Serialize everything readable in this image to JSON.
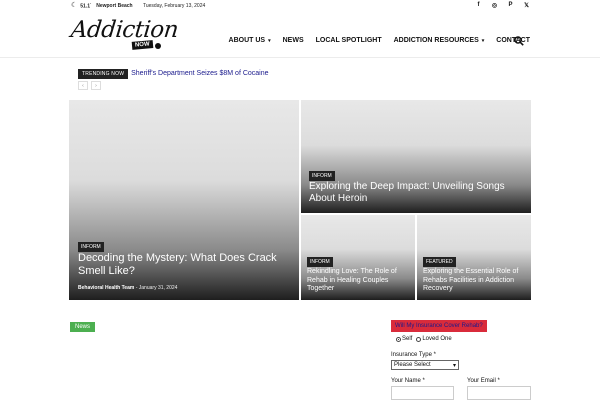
{
  "topbar": {
    "temperature": "51.1",
    "temp_unit": "°",
    "city": "Newport Beach",
    "date": "Tuesday, February 13, 2024",
    "social": [
      {
        "icon": "facebook-icon",
        "glyph": "f"
      },
      {
        "icon": "instagram-icon",
        "glyph": "◎"
      },
      {
        "icon": "pinterest-icon",
        "glyph": "P"
      },
      {
        "icon": "x-twitter-icon",
        "glyph": "𝕏"
      }
    ]
  },
  "logo": {
    "text": "Addiction",
    "badge": "NOW"
  },
  "nav": {
    "items": [
      {
        "label": "ABOUT US",
        "has_dropdown": true
      },
      {
        "label": "NEWS",
        "has_dropdown": false
      },
      {
        "label": "LOCAL SPOTLIGHT",
        "has_dropdown": false
      },
      {
        "label": "ADDICTION RESOURCES",
        "has_dropdown": true
      },
      {
        "label": "CONTACT",
        "has_dropdown": false
      }
    ]
  },
  "trending": {
    "badge": "TRENDING NOW",
    "headline": "Sheriff's Department Seizes $8M of Cocaine",
    "prev": "‹",
    "next": "›"
  },
  "grid": {
    "big": {
      "category": "INFORM",
      "title": "Decoding the Mystery: What Does Crack Smell Like?",
      "author": "Behavioral Health Team",
      "separator": " - ",
      "date": "January 31, 2024"
    },
    "right": {
      "category": "INFORM",
      "title": "Exploring the Deep Impact: Unveiling Songs About Heroin"
    },
    "small1": {
      "category": "INFORM",
      "title": "Rekindling Love: The Role of Rehab in Healing Couples Together"
    },
    "small2": {
      "category": "FEATURED",
      "title": "Exploring the Essential Role of Rehabs Facilities in Addiction Recovery"
    }
  },
  "news_label": "News",
  "form": {
    "header": "Will My Insurance Cover Rehab?",
    "options": [
      "Self",
      "Loved One"
    ],
    "insurance_label": "Insurance Type *",
    "insurance_value": "Please Select",
    "name_label": "Your Name *",
    "email_label": "Your Email *"
  }
}
